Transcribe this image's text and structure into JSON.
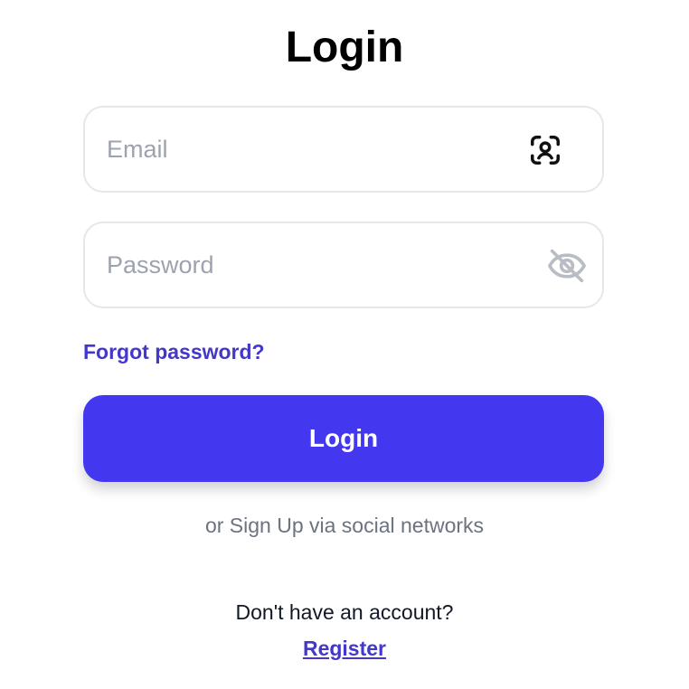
{
  "page": {
    "title": "Login"
  },
  "form": {
    "email": {
      "value": "",
      "placeholder": "Email",
      "icon": "face-id-icon"
    },
    "password": {
      "value": "",
      "placeholder": "Password",
      "icon": "eye-off-icon"
    },
    "forgot_label": "Forgot password?",
    "login_label": "Login"
  },
  "social": {
    "text": "or Sign Up via social networks"
  },
  "footer": {
    "no_account_text": "Don't have an account?",
    "register_label": "Register"
  },
  "colors": {
    "accent": "#4338f0",
    "link": "#4338ca",
    "placeholder": "#9ca3af",
    "border": "#e5e7eb"
  }
}
